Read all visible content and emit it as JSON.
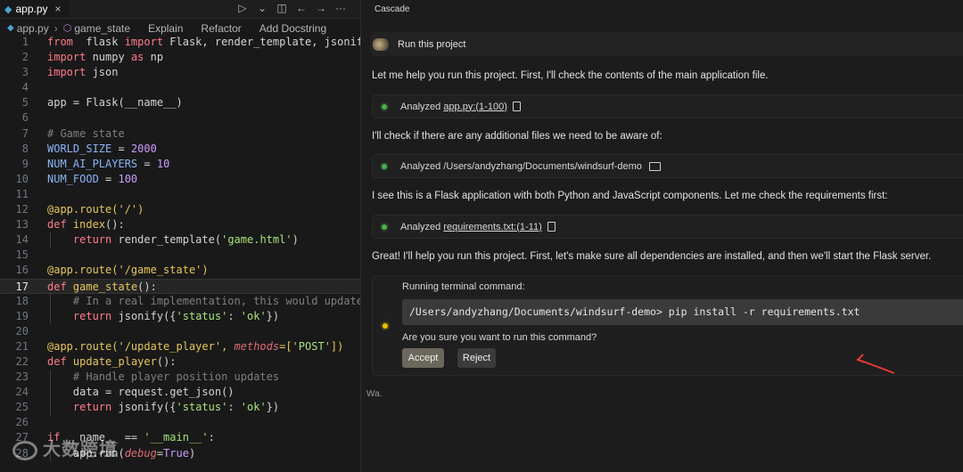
{
  "editor": {
    "tab_label": "app.py",
    "tab_icon": "python-file-icon",
    "breadcrumb": {
      "file": "app.py",
      "symbol": "game_state",
      "lenses": [
        "Explain",
        "Refactor",
        "Add Docstring"
      ]
    },
    "lines": [
      {
        "n": "1",
        "segs": [
          [
            "kw",
            "from"
          ],
          [
            "",
            "  flask "
          ],
          [
            "kw",
            "import"
          ],
          [
            "",
            " Flask, render_template, jsonify,"
          ]
        ]
      },
      {
        "n": "2",
        "segs": [
          [
            "kw",
            "import"
          ],
          [
            "",
            " numpy "
          ],
          [
            "kw",
            "as"
          ],
          [
            "",
            " np"
          ]
        ]
      },
      {
        "n": "3",
        "segs": [
          [
            "kw",
            "import"
          ],
          [
            "",
            " json"
          ]
        ]
      },
      {
        "n": "4",
        "segs": []
      },
      {
        "n": "5",
        "segs": [
          [
            "",
            "app = Flask(__name__)"
          ]
        ]
      },
      {
        "n": "6",
        "segs": []
      },
      {
        "n": "7",
        "segs": [
          [
            "cmt",
            "# Game state"
          ]
        ]
      },
      {
        "n": "8",
        "segs": [
          [
            "cst",
            "WORLD_SIZE"
          ],
          [
            "",
            " = "
          ],
          [
            "num",
            "2000"
          ]
        ]
      },
      {
        "n": "9",
        "segs": [
          [
            "cst",
            "NUM_AI_PLAYERS"
          ],
          [
            "",
            " = "
          ],
          [
            "num",
            "10"
          ]
        ]
      },
      {
        "n": "10",
        "segs": [
          [
            "cst",
            "NUM_FOOD"
          ],
          [
            "",
            " = "
          ],
          [
            "num",
            "100"
          ]
        ]
      },
      {
        "n": "11",
        "segs": []
      },
      {
        "n": "12",
        "segs": [
          [
            "dec",
            "@app.route('/')"
          ]
        ]
      },
      {
        "n": "13",
        "segs": [
          [
            "kw2",
            "def"
          ],
          [
            "",
            " "
          ],
          [
            "fn",
            "index"
          ],
          [
            "",
            "():"
          ]
        ]
      },
      {
        "n": "14",
        "segs": [
          [
            "",
            "    "
          ],
          [
            "kw",
            "return"
          ],
          [
            "",
            " render_template("
          ],
          [
            "str",
            "'game.html'"
          ],
          [
            "",
            ")"
          ]
        ]
      },
      {
        "n": "15",
        "segs": []
      },
      {
        "n": "16",
        "segs": [
          [
            "dec",
            "@app.route('/game_state')"
          ]
        ]
      },
      {
        "n": "17",
        "segs": [
          [
            "kw2",
            "def"
          ],
          [
            "",
            " "
          ],
          [
            "fn",
            "game_state"
          ],
          [
            "",
            "():"
          ]
        ],
        "active": true
      },
      {
        "n": "18",
        "segs": [
          [
            "",
            "    "
          ],
          [
            "cmt",
            "# In a real implementation, this would update"
          ]
        ]
      },
      {
        "n": "19",
        "segs": [
          [
            "",
            "    "
          ],
          [
            "kw",
            "return"
          ],
          [
            "",
            " jsonify({"
          ],
          [
            "str",
            "'status'"
          ],
          [
            "",
            ": "
          ],
          [
            "str",
            "'ok'"
          ],
          [
            "",
            "})"
          ]
        ]
      },
      {
        "n": "20",
        "segs": []
      },
      {
        "n": "21",
        "segs": [
          [
            "dec",
            "@app.route('/update_player', "
          ],
          [
            "prm",
            "methods"
          ],
          [
            "dec",
            "=['"
          ],
          [
            "str",
            "POST"
          ],
          [
            "dec",
            "'])"
          ]
        ]
      },
      {
        "n": "22",
        "segs": [
          [
            "kw2",
            "def"
          ],
          [
            "",
            " "
          ],
          [
            "fn",
            "update_player"
          ],
          [
            "",
            "():"
          ]
        ]
      },
      {
        "n": "23",
        "segs": [
          [
            "",
            "    "
          ],
          [
            "cmt",
            "# Handle player position updates"
          ]
        ]
      },
      {
        "n": "24",
        "segs": [
          [
            "",
            "    data = request.get_json()"
          ]
        ]
      },
      {
        "n": "25",
        "segs": [
          [
            "",
            "    "
          ],
          [
            "kw",
            "return"
          ],
          [
            "",
            " jsonify({"
          ],
          [
            "str",
            "'status'"
          ],
          [
            "",
            ": "
          ],
          [
            "str",
            "'ok'"
          ],
          [
            "",
            "})"
          ]
        ]
      },
      {
        "n": "26",
        "segs": []
      },
      {
        "n": "27",
        "segs": [
          [
            "kw",
            "if"
          ],
          [
            "",
            " __name__ == "
          ],
          [
            "str",
            "'__main__'"
          ],
          [
            "",
            ":"
          ]
        ]
      },
      {
        "n": "28",
        "segs": [
          [
            "",
            "    app.run("
          ],
          [
            "prm",
            "debug"
          ],
          [
            "",
            "="
          ],
          [
            "bool",
            "True"
          ],
          [
            "",
            ")"
          ]
        ]
      }
    ],
    "watermark": "大数跨境"
  },
  "cascade": {
    "title": "Cascade",
    "user_message": "Run this project",
    "paragraphs": [
      "Let me help you run this project. First, I'll check the contents of the main application file.",
      "I'll check if there are any additional files we need to be aware of:",
      "I see this is a Flask application with both Python and JavaScript components. Let me check the requirements first:",
      "Great! I'll help you run this project. First, let's make sure all dependencies are installed, and then we'll start the Flask server."
    ],
    "steps": [
      {
        "prefix": "Analyzed ",
        "target": "app.py:(1-100)",
        "link": true,
        "icon": "file-icon"
      },
      {
        "prefix": "Analyzed ",
        "target": "/Users/andyzhang/Documents/windsurf-demo",
        "link": false,
        "icon": "folder-icon"
      },
      {
        "prefix": "Analyzed ",
        "target": "requirements.txt:(1-11)",
        "link": true,
        "icon": "file-icon"
      }
    ],
    "terminal": {
      "label": "Running terminal command:",
      "command": "/Users/andyzhang/Documents/windsurf-demo> pip install -r requirements.txt",
      "question": "Are you sure you want to run this command?",
      "accept_label": "Accept",
      "reject_label": "Reject"
    },
    "waiting_text": "Wa."
  },
  "colors": {
    "background": "#1b1b1b",
    "keyword": "#ff7b8a",
    "string": "#a7e37a",
    "number": "#cd9bff",
    "decorator": "#e6c65b",
    "success_dot": "#4caf50",
    "pending_dot": "#e5c100",
    "annotation_arrow": "#e53935"
  }
}
